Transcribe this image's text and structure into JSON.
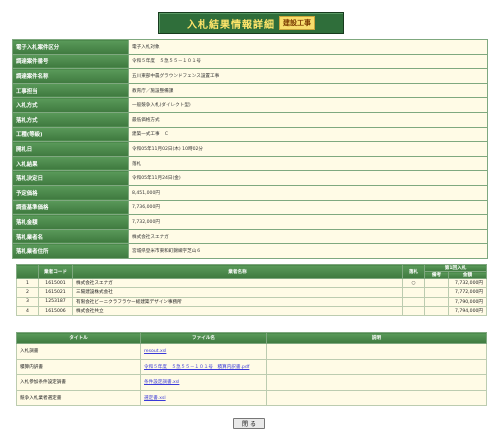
{
  "header": {
    "title": "入札結果情報詳細",
    "badge": "建設工事"
  },
  "details": [
    {
      "label": "電子入札案件区分",
      "value": "電子入札対象"
    },
    {
      "label": "調達案件番号",
      "value": "令和５年度　５急５５－１０１号"
    },
    {
      "label": "調達案件名称",
      "value": "五川東部中農グラウンドフェンス設置工事"
    },
    {
      "label": "工事担当",
      "value": "教育庁／施設整備課"
    },
    {
      "label": "入札方式",
      "value": "一般競争入札(ダイレクト型)"
    },
    {
      "label": "落札方式",
      "value": "最低価格方式"
    },
    {
      "label": "工種(等級)",
      "value": "建築一式工事　Ｃ"
    },
    {
      "label": "開札日",
      "value": "令和05年11月02日(木) 10時02分"
    },
    {
      "label": "入札結果",
      "value": "落札"
    },
    {
      "label": "落札決定日",
      "value": "令和05年11月24日(金)"
    },
    {
      "label": "予定価格",
      "value": "8,451,000円"
    },
    {
      "label": "調査基準価格",
      "value": "7,736,000円"
    },
    {
      "label": "落札金額",
      "value": "7,732,000円"
    },
    {
      "label": "落札業者名",
      "value": "株式会社スエナガ"
    },
    {
      "label": "落札業者住所",
      "value": "宮城県登米市東和町錦織字芝山６"
    }
  ],
  "bidders": {
    "headers": {
      "no": "",
      "code": "業者コード",
      "name": "業者名称",
      "award": "落札",
      "round_group": "第1回入札",
      "remarks": "備考",
      "amount": "金額"
    },
    "rows": [
      {
        "no": "1",
        "code": "1615001",
        "name": "株式会社スエナガ",
        "award": "○",
        "remarks": "",
        "amount": "7,732,000円"
      },
      {
        "no": "2",
        "code": "1615021",
        "name": "三陽建設株式会社",
        "award": "",
        "remarks": "",
        "amount": "7,772,000円"
      },
      {
        "no": "3",
        "code": "1253187",
        "name": "有限会社ビーニクラフラウー総建築デザイン事務所",
        "award": "",
        "remarks": "",
        "amount": "7,790,000円"
      },
      {
        "no": "4",
        "code": "1615006",
        "name": "株式会社共立",
        "award": "",
        "remarks": "",
        "amount": "7,794,000円"
      }
    ]
  },
  "documents": {
    "headers": {
      "title": "タイトル",
      "file": "ファイル名",
      "note": "説明"
    },
    "rows": [
      {
        "title": "入札調書",
        "file": "resout.xsl"
      },
      {
        "title": "積算内訳書",
        "file": "令和５年度　５急５５－１０１号　積算内訳書.pdf"
      },
      {
        "title": "入札参加条件設定調書",
        "file": "条件設定調書.xsl"
      },
      {
        "title": "競争入札業者選定書",
        "file": "選定書.xsl"
      }
    ]
  },
  "close_button": {
    "label": "閉 る"
  }
}
